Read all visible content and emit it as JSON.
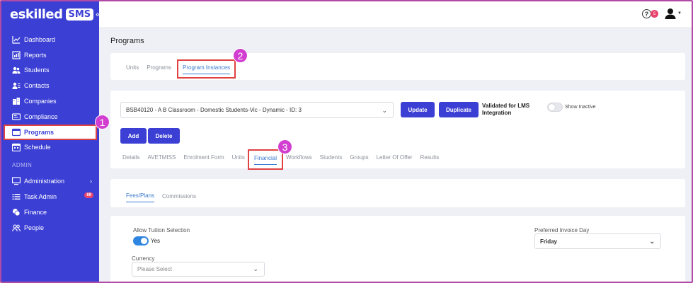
{
  "app": {
    "logo_text": "eskilled",
    "logo_badge": "SMS",
    "collapse_glyph": "«"
  },
  "sidebar": {
    "items": [
      {
        "label": "Dashboard",
        "icon": "chart-line-icon"
      },
      {
        "label": "Reports",
        "icon": "reports-icon"
      },
      {
        "label": "Students",
        "icon": "students-icon"
      },
      {
        "label": "Contacts",
        "icon": "contacts-icon"
      },
      {
        "label": "Companies",
        "icon": "companies-icon"
      },
      {
        "label": "Compliance",
        "icon": "compliance-icon"
      },
      {
        "label": "Programs",
        "icon": "programs-icon"
      },
      {
        "label": "Schedule",
        "icon": "schedule-icon"
      }
    ],
    "section_admin": "ADMIN",
    "admin_items": [
      {
        "label": "Administration",
        "icon": "monitor-icon"
      },
      {
        "label": "Task Admin",
        "icon": "list-icon",
        "count": "69"
      },
      {
        "label": "Finance",
        "icon": "coins-icon"
      },
      {
        "label": "People",
        "icon": "people-icon"
      }
    ]
  },
  "topbar": {
    "help_glyph": "?",
    "notification_count": "5"
  },
  "page": {
    "title": "Programs"
  },
  "main_tabs": [
    "Units",
    "Programs",
    "Program Instances"
  ],
  "instance": {
    "selected": "BSB40120 - A B Classroom - Domestic Students-Vic - Dynamic - ID: 3",
    "update_label": "Update",
    "duplicate_label": "Duplicate",
    "validated_label": "Validated for LMS Integration",
    "show_inactive_label": "Show Inactive",
    "add_label": "Add",
    "delete_label": "Delete"
  },
  "instance_tabs": [
    "Details",
    "AVETMISS",
    "Enrolment Form",
    "Units",
    "Financial",
    "Workflows",
    "Students",
    "Groups",
    "Letter Of Offer",
    "Results"
  ],
  "financial_tabs": [
    "Fees/Plans",
    "Commissions"
  ],
  "form": {
    "allow_tuition_label": "Allow Tuition Selection",
    "allow_tuition_value": "Yes",
    "currency_label": "Currency",
    "currency_placeholder": "Please Select",
    "invoice_day_label": "Preferred Invoice Day",
    "invoice_day_value": "Friday"
  },
  "steps": [
    "1",
    "2",
    "3"
  ],
  "colors": {
    "brand": "#3b3fd4",
    "accent": "#3b7bd1",
    "highlight": "#e04141",
    "step": "#d23fd0"
  }
}
